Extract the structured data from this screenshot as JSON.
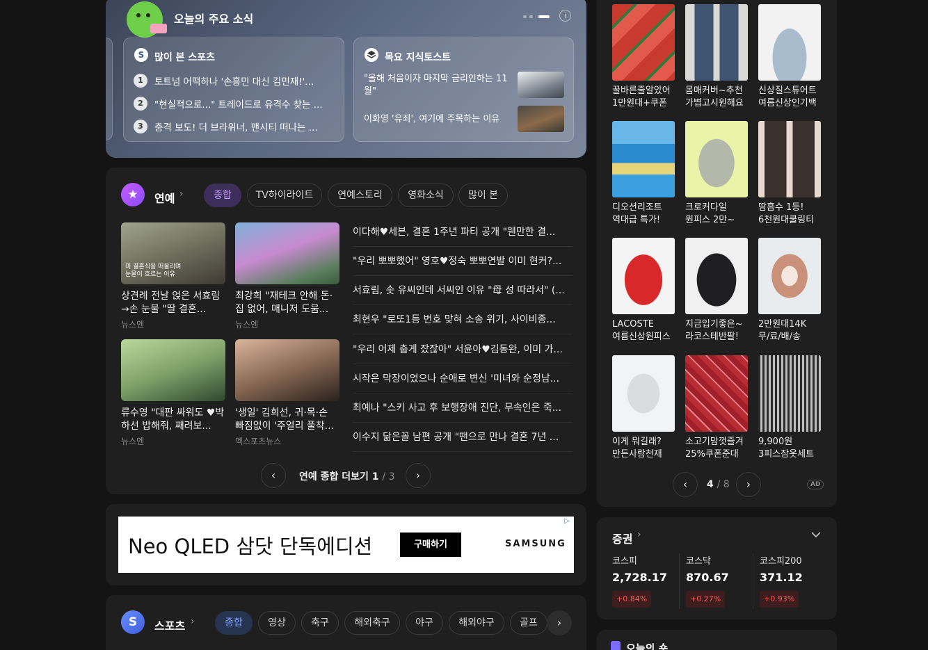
{
  "today": {
    "title": "오늘의 주요 소식",
    "info_glyph": "i",
    "sports_card": {
      "icon_glyph": "S",
      "title": "많이 본 스포츠",
      "items": [
        {
          "rank": "1",
          "text": "토트넘 어떡하나 '손흥민 대신 김민재!'..."
        },
        {
          "rank": "2",
          "text": "\"현실적으로...\" 트레이드로 유격수 찾는 ..."
        },
        {
          "rank": "3",
          "text": "충격 보도! 더 브라위너, 맨시티 떠나는 ..."
        }
      ]
    },
    "knowledge_card": {
      "title": "목요 지식토스트",
      "items": [
        {
          "text": "\"올해 처음이자 마지막 금리인하는 11월\""
        },
        {
          "text": "이화영 '유죄', 여기에 주목하는 이유"
        }
      ]
    }
  },
  "entertainment": {
    "title": "연예",
    "icon_glyph": "★",
    "chevron": "›",
    "tabs": [
      "종합",
      "TV하이라이트",
      "연예스토리",
      "영화소식",
      "많이 본"
    ],
    "cards": [
      {
        "caption": "상견례 전날 얹은 서효림→손 눈물 \"딸 결혼...",
        "source": "뉴스엔",
        "overlay": "미 결혼식을 떠올리며\n눈물이 흐르는 이유",
        "color": "#7a8a6c"
      },
      {
        "caption": "최강희 \"재테크 안해 돈·집 없어, 매니저 도움...",
        "source": "뉴스엔",
        "overlay": "",
        "color": "#5d6d8a"
      },
      {
        "caption": "류수영 \"대판 싸워도 ♥박하선 밥해줘, 째려보...",
        "source": "뉴스엔",
        "overlay": "",
        "color": "#6c8a5a"
      },
      {
        "caption": "'생일' 김희선, 귀·목·손 빠짐없이 '주얼리 풀착...",
        "source": "엑스포츠뉴스",
        "overlay": "",
        "color": "#8a7a6c"
      }
    ],
    "headlines": [
      "이다해♥세븐, 결혼 1주년 파티 공개 \"웬만한 결...",
      "\"우리 뽀뽀했어\" 영호♥정숙 뽀뽀연발 이미 현커?...",
      "서효림, 솟 유씨인데 서씨인 이유 \"母 성 따라서\" (...",
      "최현우 \"로또1등 번호 맞혀 소송 위기, 사이비종...",
      "\"우리 어제 춥게 잤잖아\" 서윤아♥김동완, 이미 가...",
      "시작은 막장이었으나 순애로 변신 '미녀와 순정남...",
      "최예나 \"스키 사고 후 보행장애 진단, 무속인은 죽...",
      "이수지 닮은꼴 남편 공개 \"팬으로 만나 결혼 7년 ..."
    ],
    "pager": {
      "label": "연예 종합 더보기",
      "current": "1",
      "total": "/ 3",
      "prev": "‹",
      "next": "›"
    }
  },
  "ad": {
    "text": "Neo QLED 삼닷 단독에디션",
    "button": "구매하기",
    "brand": "SAMSUNG",
    "mark": "▷"
  },
  "sports": {
    "title": "스포츠",
    "icon_glyph": "S",
    "chevron": "›",
    "tabs": [
      "종합",
      "영상",
      "축구",
      "해외축구",
      "야구",
      "해외야구",
      "골프"
    ],
    "next": "›"
  },
  "shopping": {
    "products": [
      {
        "line1": "꿀바른줄알았어",
        "line2": "1만원대+쿠폰",
        "color": "#c93a2e",
        "icon": "watermelon-image"
      },
      {
        "line1": "몸매커버~추천",
        "line2": "가볍고시원해요",
        "color": "#4a5f78",
        "icon": "dress-image"
      },
      {
        "line1": "신상질스튜어트",
        "line2": "여름신상인기백",
        "color": "#9eb3c6",
        "icon": "bag-image"
      },
      {
        "line1": "디오션리조트",
        "line2": "역대급 특가!",
        "color": "#3a8fd0",
        "icon": "resort-image"
      },
      {
        "line1": "크로커다일",
        "line2": "원피스 2만~",
        "color": "#b9bdb0",
        "icon": "onepiece-image"
      },
      {
        "line1": "땀흡수 1등!",
        "line2": "6천원대쿨링티",
        "color": "#7a6a5e",
        "icon": "tshirt-image"
      },
      {
        "line1": "LACOSTE",
        "line2": "여름신상원피스",
        "color": "#d8282a",
        "icon": "red-dress-image"
      },
      {
        "line1": "지금입기좋은~",
        "line2": "라코스테반팔!",
        "color": "#1f1f22",
        "icon": "black-tshirt-image"
      },
      {
        "line1": "2만원대14K",
        "line2": "무/료/배/송",
        "color": "#c9907a",
        "icon": "ring-image"
      },
      {
        "line1": "이게 뭐길래?",
        "line2": "만든사람천재",
        "color": "#cfd3d6",
        "icon": "phone-case-image"
      },
      {
        "line1": "소고기맘껏즐겨",
        "line2": "25%쿠폰준대",
        "color": "#b82c34",
        "icon": "beef-image"
      },
      {
        "line1": "9,900원",
        "line2": "3피스잠옷세트",
        "color": "#5a5a5a",
        "icon": "pajama-image"
      }
    ],
    "pager": {
      "current": "4",
      "total": "/ 8",
      "prev": "‹",
      "next": "›"
    },
    "ad_tag": "AD"
  },
  "stocks": {
    "title": "증권",
    "chevron": "›",
    "expand": "⌄",
    "items": [
      {
        "name": "코스피",
        "value": "2,728.17",
        "change": "+0.84%"
      },
      {
        "name": "코스닥",
        "value": "870.67",
        "change": "+0.27%"
      },
      {
        "name": "코스피200",
        "value": "371.12",
        "change": "+0.93%"
      }
    ],
    "up_color": "#ff5a5a"
  },
  "bottom": {
    "title": "오늘의 숏"
  }
}
